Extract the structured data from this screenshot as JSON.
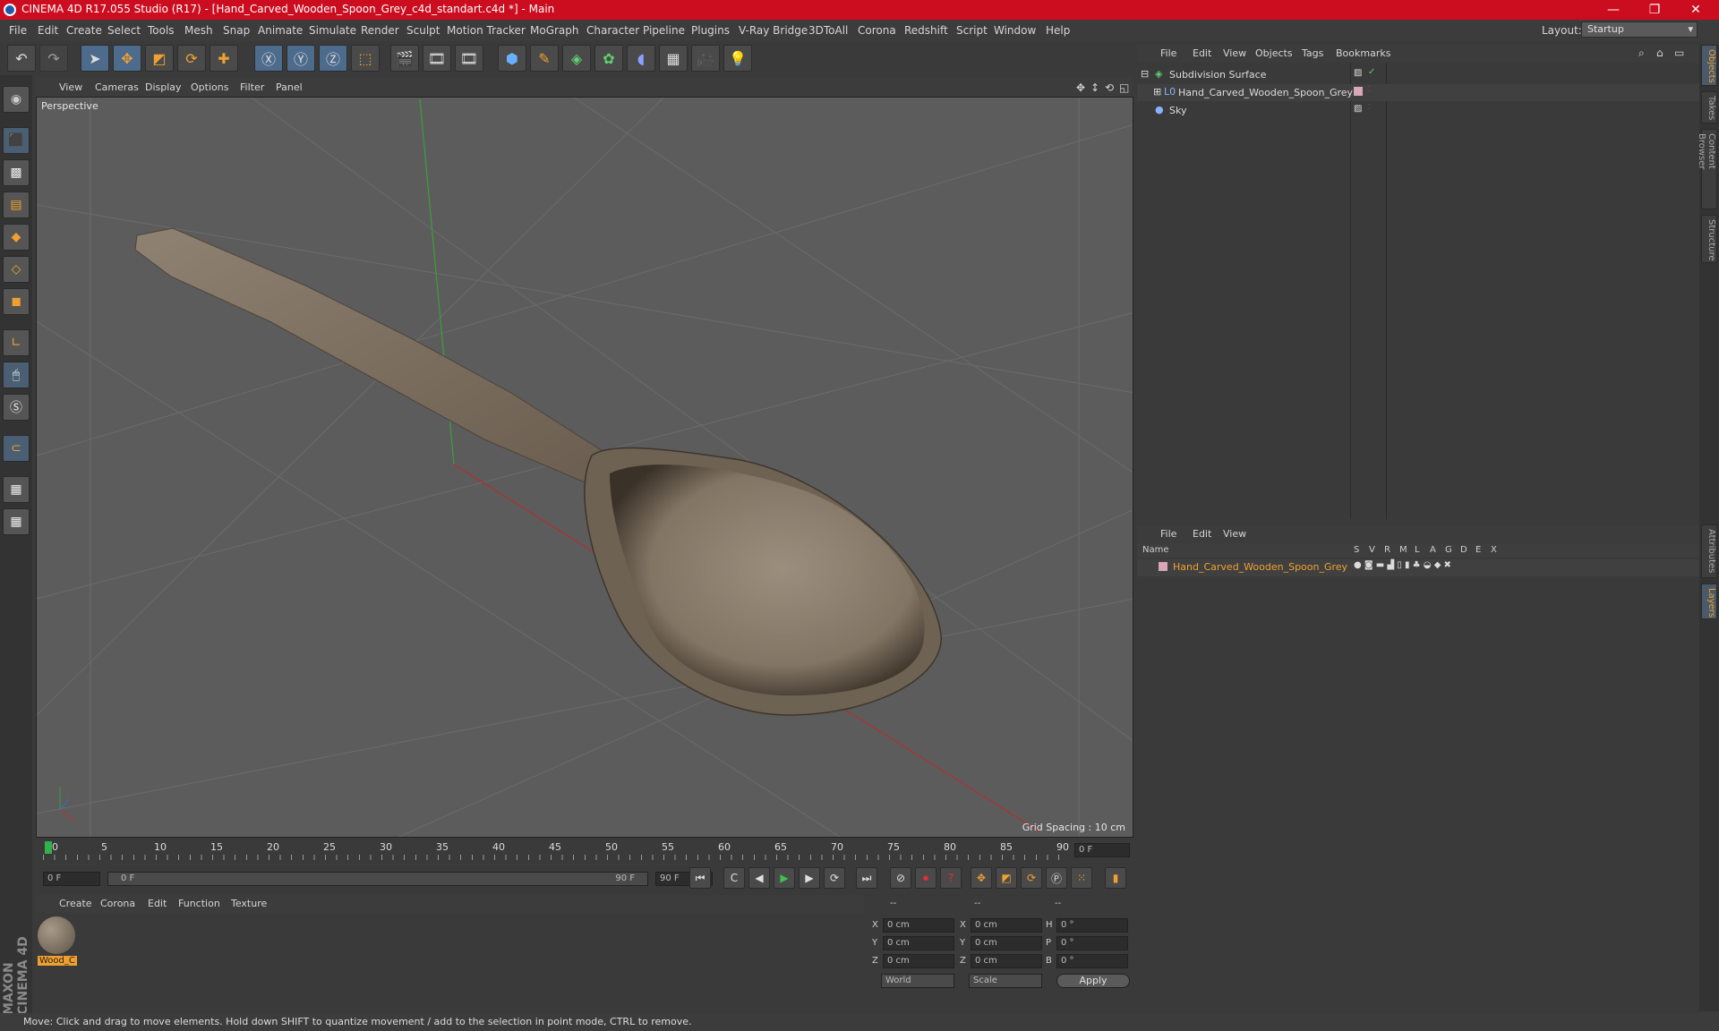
{
  "window": {
    "title": "CINEMA 4D R17.055 Studio (R17) - [Hand_Carved_Wooden_Spoon_Grey_c4d_standart.c4d *] - Main",
    "minimize": "—",
    "maximize": "❐",
    "close": "✕"
  },
  "menubar": {
    "items": [
      "File",
      "Edit",
      "Create",
      "Select",
      "Tools",
      "Mesh",
      "Snap",
      "Animate",
      "Simulate",
      "Render",
      "Sculpt",
      "Motion Tracker",
      "MoGraph",
      "Character",
      "Pipeline",
      "Plugins",
      "V-Ray Bridge",
      "3DToAll",
      "Corona",
      "Redshift",
      "Script",
      "Window",
      "Help"
    ],
    "layout_label": "Layout:",
    "layout_value": "Startup"
  },
  "viewport": {
    "menu": [
      "View",
      "Cameras",
      "Display",
      "Options",
      "Filter",
      "Panel"
    ],
    "label": "Perspective",
    "grid_info": "Grid Spacing : 10 cm"
  },
  "timeline": {
    "ticks": [
      "0",
      "5",
      "10",
      "15",
      "20",
      "25",
      "30",
      "35",
      "40",
      "45",
      "50",
      "55",
      "60",
      "65",
      "70",
      "75",
      "80",
      "85",
      "90"
    ],
    "frame_field": "0 F",
    "start_field": "0 F",
    "range_start": "0 F",
    "range_end": "90 F",
    "end_field": "90 F"
  },
  "material": {
    "menu": [
      "Create",
      "Corona",
      "Edit",
      "Function",
      "Texture"
    ],
    "item_label": "Wood_C"
  },
  "coords": {
    "header": [
      "--",
      "--",
      "--"
    ],
    "rows": [
      {
        "a": "X",
        "av": "0 cm",
        "b": "X",
        "bv": "0 cm",
        "c": "H",
        "cv": "0 °"
      },
      {
        "a": "Y",
        "av": "0 cm",
        "b": "Y",
        "bv": "0 cm",
        "c": "P",
        "cv": "0 °"
      },
      {
        "a": "Z",
        "av": "0 cm",
        "b": "Z",
        "bv": "0 cm",
        "c": "B",
        "cv": "0 °"
      }
    ],
    "world": "World",
    "scale": "Scale",
    "apply": "Apply"
  },
  "objects": {
    "menu": [
      "File",
      "Edit",
      "View",
      "Objects",
      "Tags",
      "Bookmarks"
    ],
    "rows": [
      "Subdivision Surface",
      "Hand_Carved_Wooden_Spoon_Grey",
      "Sky"
    ]
  },
  "layers": {
    "menu": [
      "File",
      "Edit",
      "View"
    ],
    "col_name": "Name",
    "cols": [
      "S",
      "V",
      "R",
      "M",
      "L",
      "A",
      "G",
      "D",
      "E",
      "X"
    ],
    "row": "Hand_Carved_Wooden_Spoon_Grey"
  },
  "side_tabs": [
    "Objects",
    "Takes",
    "Content Browser",
    "Structure",
    "Attributes",
    "Layers"
  ],
  "status": "Move: Click and drag to move elements. Hold down SHIFT to quantize movement / add to the selection in point mode, CTRL to remove.",
  "brand": "MAXON CINEMA 4D"
}
